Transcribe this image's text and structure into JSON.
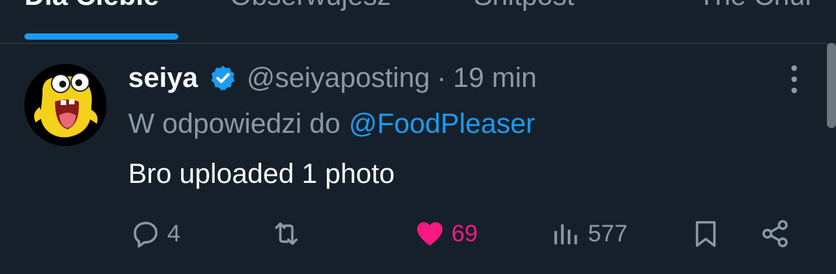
{
  "tabs": [
    {
      "label": "Dla Ciebie",
      "active": true
    },
    {
      "label": "Obserwujesz",
      "active": false
    },
    {
      "label": "Shitpost",
      "active": false
    },
    {
      "label": "The Chur",
      "active": false
    }
  ],
  "post": {
    "display_name": "seiya",
    "verified": true,
    "handle": "@seiyaposting",
    "separator": "·",
    "time": "19 min",
    "reply_prefix": "W odpowiedzi do",
    "reply_to": "@FoodPleaser",
    "text": "Bro uploaded 1 photo",
    "avatar_icon": "yellow-cartoon-character-avatar"
  },
  "actions": {
    "replies": "4",
    "reposts": "",
    "likes": "69",
    "views": "577"
  },
  "colors": {
    "background": "#15202b",
    "accent": "#1d9bf0",
    "like": "#f91880",
    "muted": "#8b98a5",
    "text": "#f7f9f9"
  }
}
